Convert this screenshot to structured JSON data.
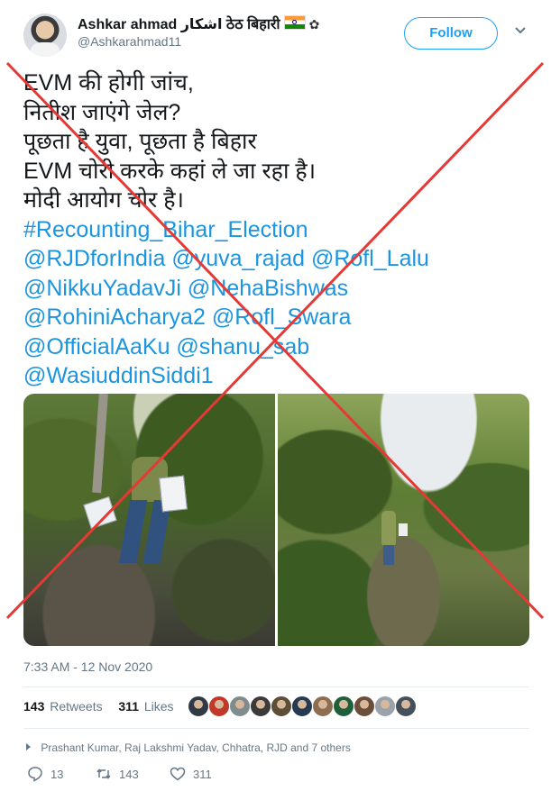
{
  "header": {
    "display_name": "Ashkar ahmad اشکار ठेठ बिहारी",
    "handle": "@Ashkarahmad11",
    "follow_label": "Follow",
    "chevron_icon": "chevron-down-icon",
    "flag_icon": "india-flag-icon",
    "gear_icon": "gear-icon"
  },
  "tweet": {
    "hindi_lines": [
      "EVM की होगी जांच,",
      "नितीश जाएंगे जेल?",
      "पूछता है युवा, पूछता है बिहार",
      "EVM चोरी करके कहां ले जा रहा है।",
      "मोदी आयोग चोर है।"
    ],
    "link_lines": [
      "#Recounting_Bihar_Election",
      "@RJDforIndia @yuva_rajad @Rofl_Lalu",
      "@NikkuYadavJi @NehaBishwas",
      "@RohiniAcharya2 @Rofl_Swara",
      "@OfficialAaKu @shanu_sab",
      "@WasiuddinSiddi1"
    ],
    "timestamp": "7:33 AM - 12 Nov 2020",
    "retweets_count": "143",
    "retweets_label": "Retweets",
    "likes_count": "311",
    "likes_label": "Likes",
    "replied_by": "Prashant Kumar, Raj Lakshmi Yadav, Chhatra, RJD and 7 others",
    "replies_count": "13",
    "retweet_count_action": "143",
    "like_count_action": "311"
  },
  "colors": {
    "link": "#1b95e0",
    "follow": "#1da1f2",
    "muted": "#657786",
    "cross": "#e53935"
  },
  "likers": [
    "#2f3a44",
    "#c0392b",
    "#7f8c8d",
    "#3b3b3b",
    "#5d4e37",
    "#263b52",
    "#8e6e53",
    "#1f5f3b",
    "#6b4f3a",
    "#9aa3ab",
    "#44515c"
  ]
}
